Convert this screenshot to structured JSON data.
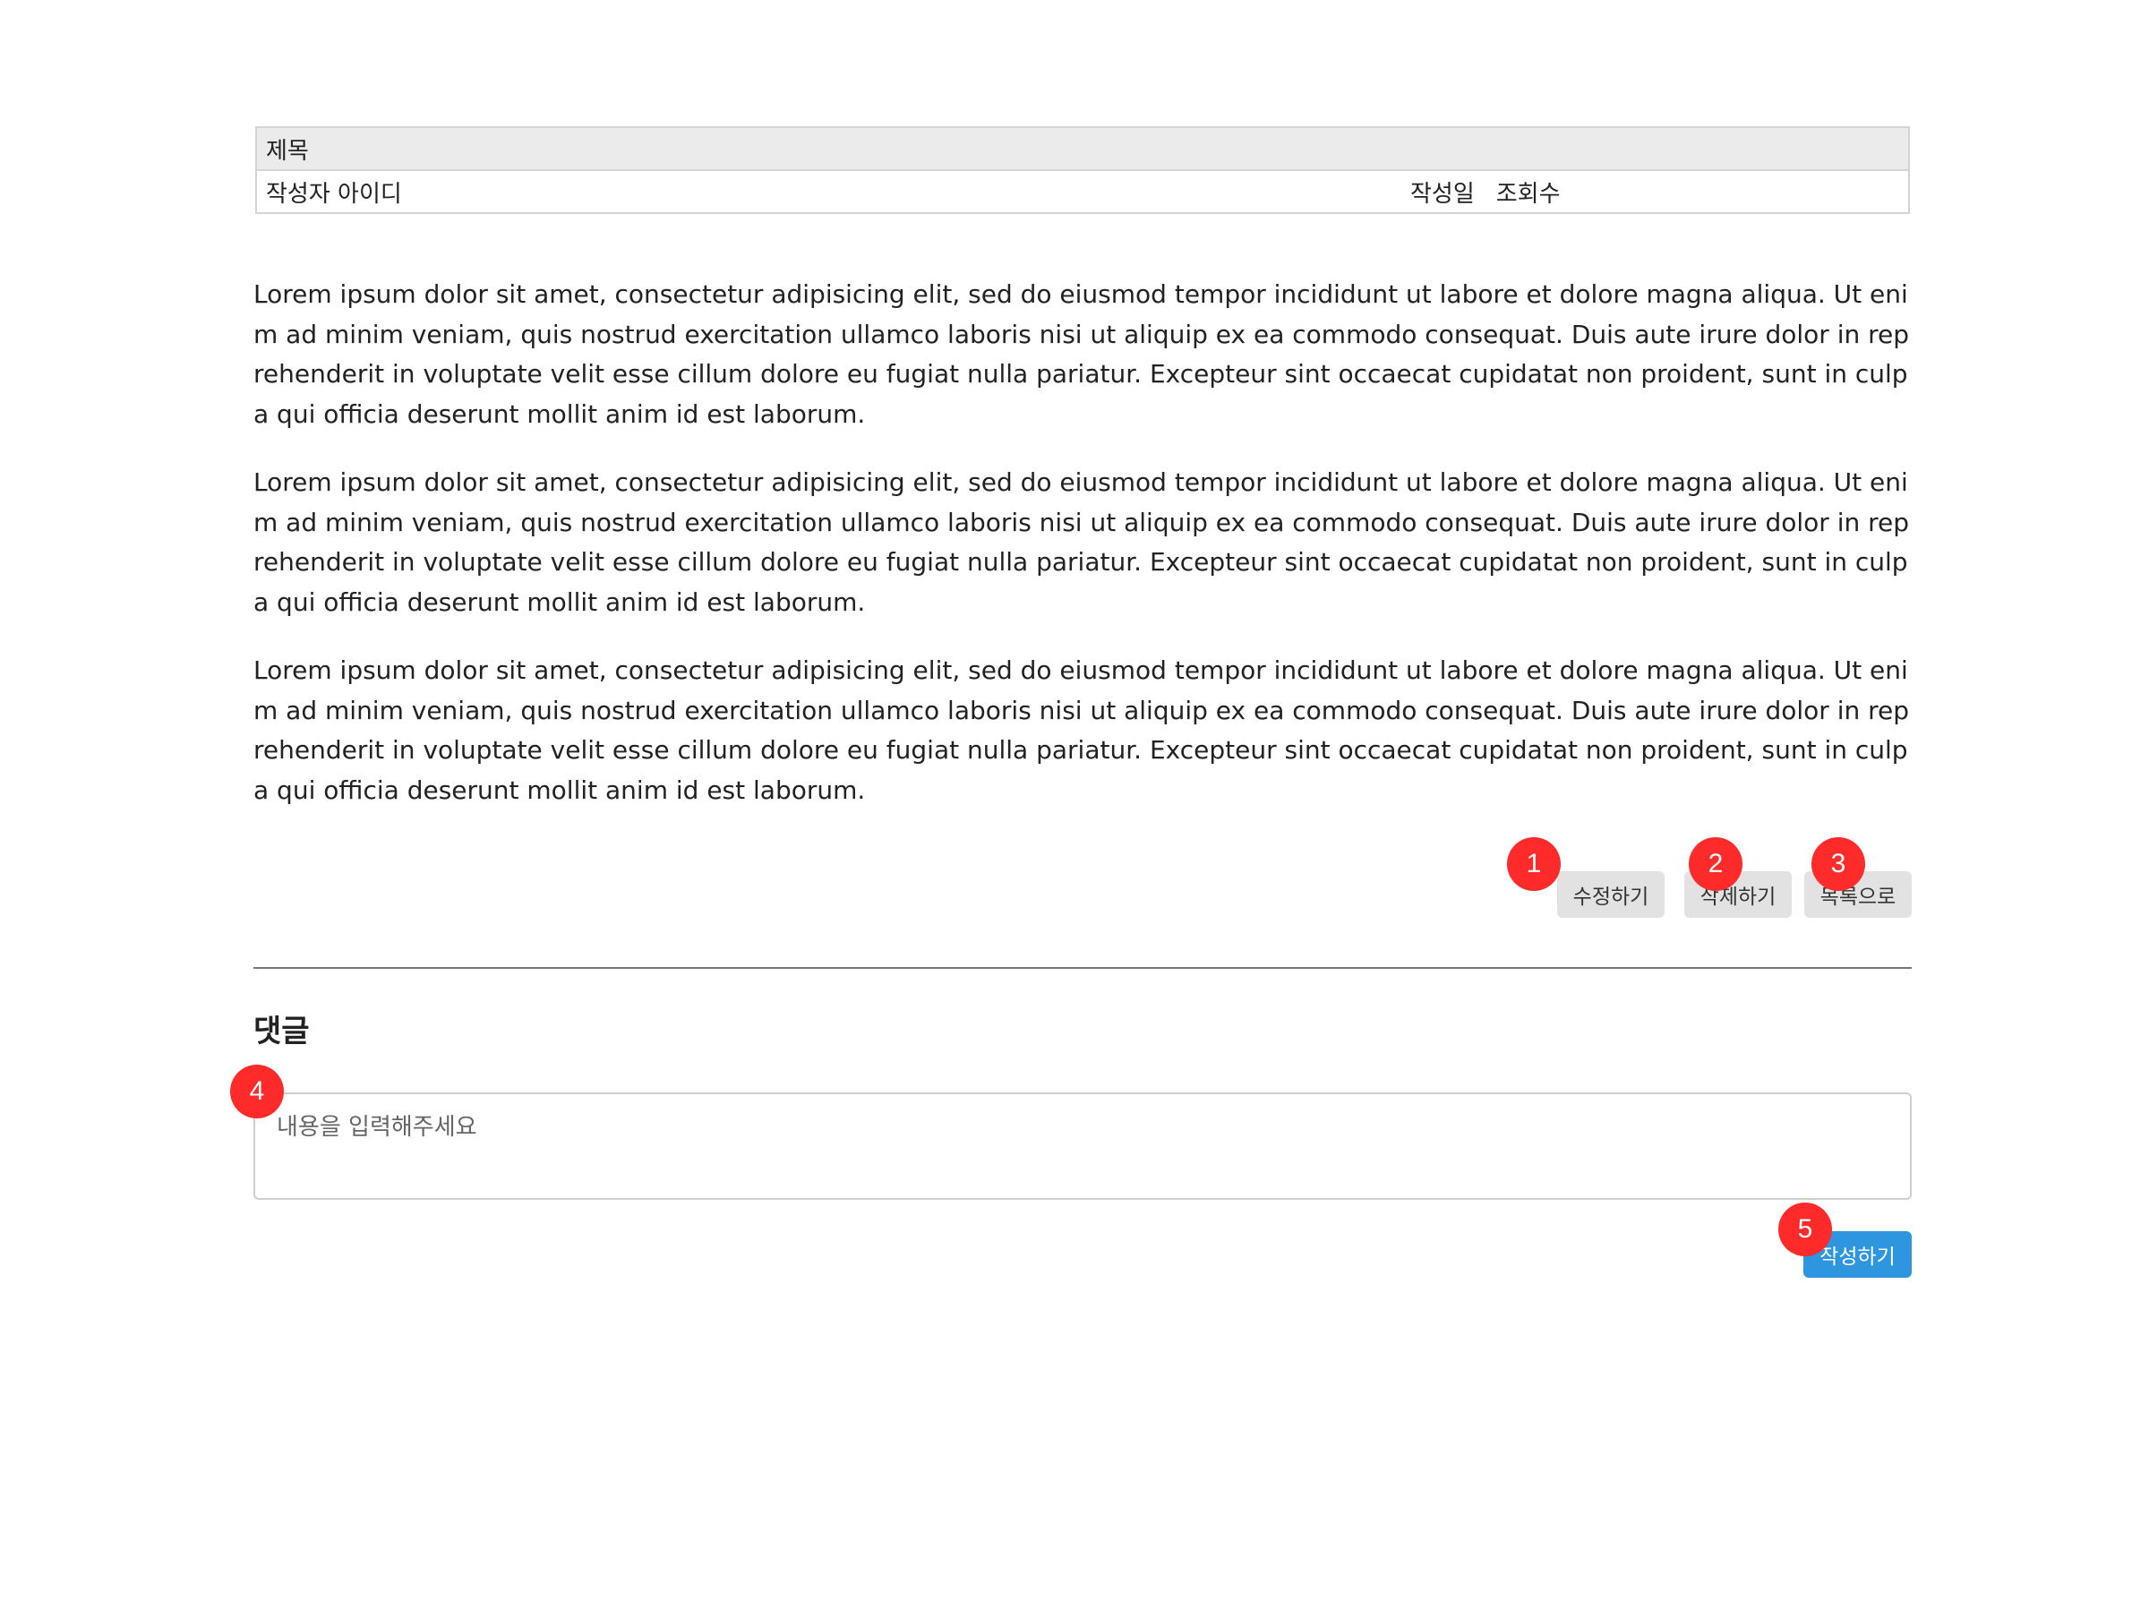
{
  "post": {
    "title": "제목",
    "author": "작성자 아이디",
    "date_label": "작성일",
    "views_label": "조회수",
    "paragraphs": [
      "Lorem ipsum dolor sit amet, consectetur adipisicing elit, sed do eiusmod tempor incididunt ut labore et dolore magna aliqua. Ut enim ad minim veniam, quis nostrud exercitation ullamco laboris nisi ut aliquip ex ea commodo consequat. Duis aute irure dolor in reprehenderit in voluptate velit esse cillum dolore eu fugiat nulla pariatur. Excepteur sint occaecat cupidatat non proident, sunt in culpa qui officia deserunt mollit anim id est laborum.",
      "Lorem ipsum dolor sit amet, consectetur adipisicing elit, sed do eiusmod tempor incididunt ut labore et dolore magna aliqua. Ut enim ad minim veniam, quis nostrud exercitation ullamco laboris nisi ut aliquip ex ea commodo consequat. Duis aute irure dolor in reprehenderit in voluptate velit esse cillum dolore eu fugiat nulla pariatur. Excepteur sint occaecat cupidatat non proident, sunt in culpa qui officia deserunt mollit anim id est laborum.",
      "Lorem ipsum dolor sit amet, consectetur adipisicing elit, sed do eiusmod tempor incididunt ut labore et dolore magna aliqua. Ut enim ad minim veniam, quis nostrud exercitation ullamco laboris nisi ut aliquip ex ea commodo consequat. Duis aute irure dolor in reprehenderit in voluptate velit esse cillum dolore eu fugiat nulla pariatur. Excepteur sint occaecat cupidatat non proident, sunt in culpa qui officia deserunt mollit anim id est laborum."
    ]
  },
  "actions": {
    "edit_label": "수정하기",
    "delete_label": "삭제하기",
    "list_label": "목록으로"
  },
  "comments": {
    "title": "댓글",
    "input_placeholder": "내용을 입력해주세요",
    "submit_label": "작성하기"
  },
  "annotations": {
    "edit": "1",
    "delete": "2",
    "list": "3",
    "comment_input": "4",
    "submit": "5"
  },
  "colors": {
    "badge": "#ff2a2a",
    "submit_button": "#2d96de",
    "secondary_button": "#e2e2e2",
    "header_background": "#ebebeb"
  }
}
